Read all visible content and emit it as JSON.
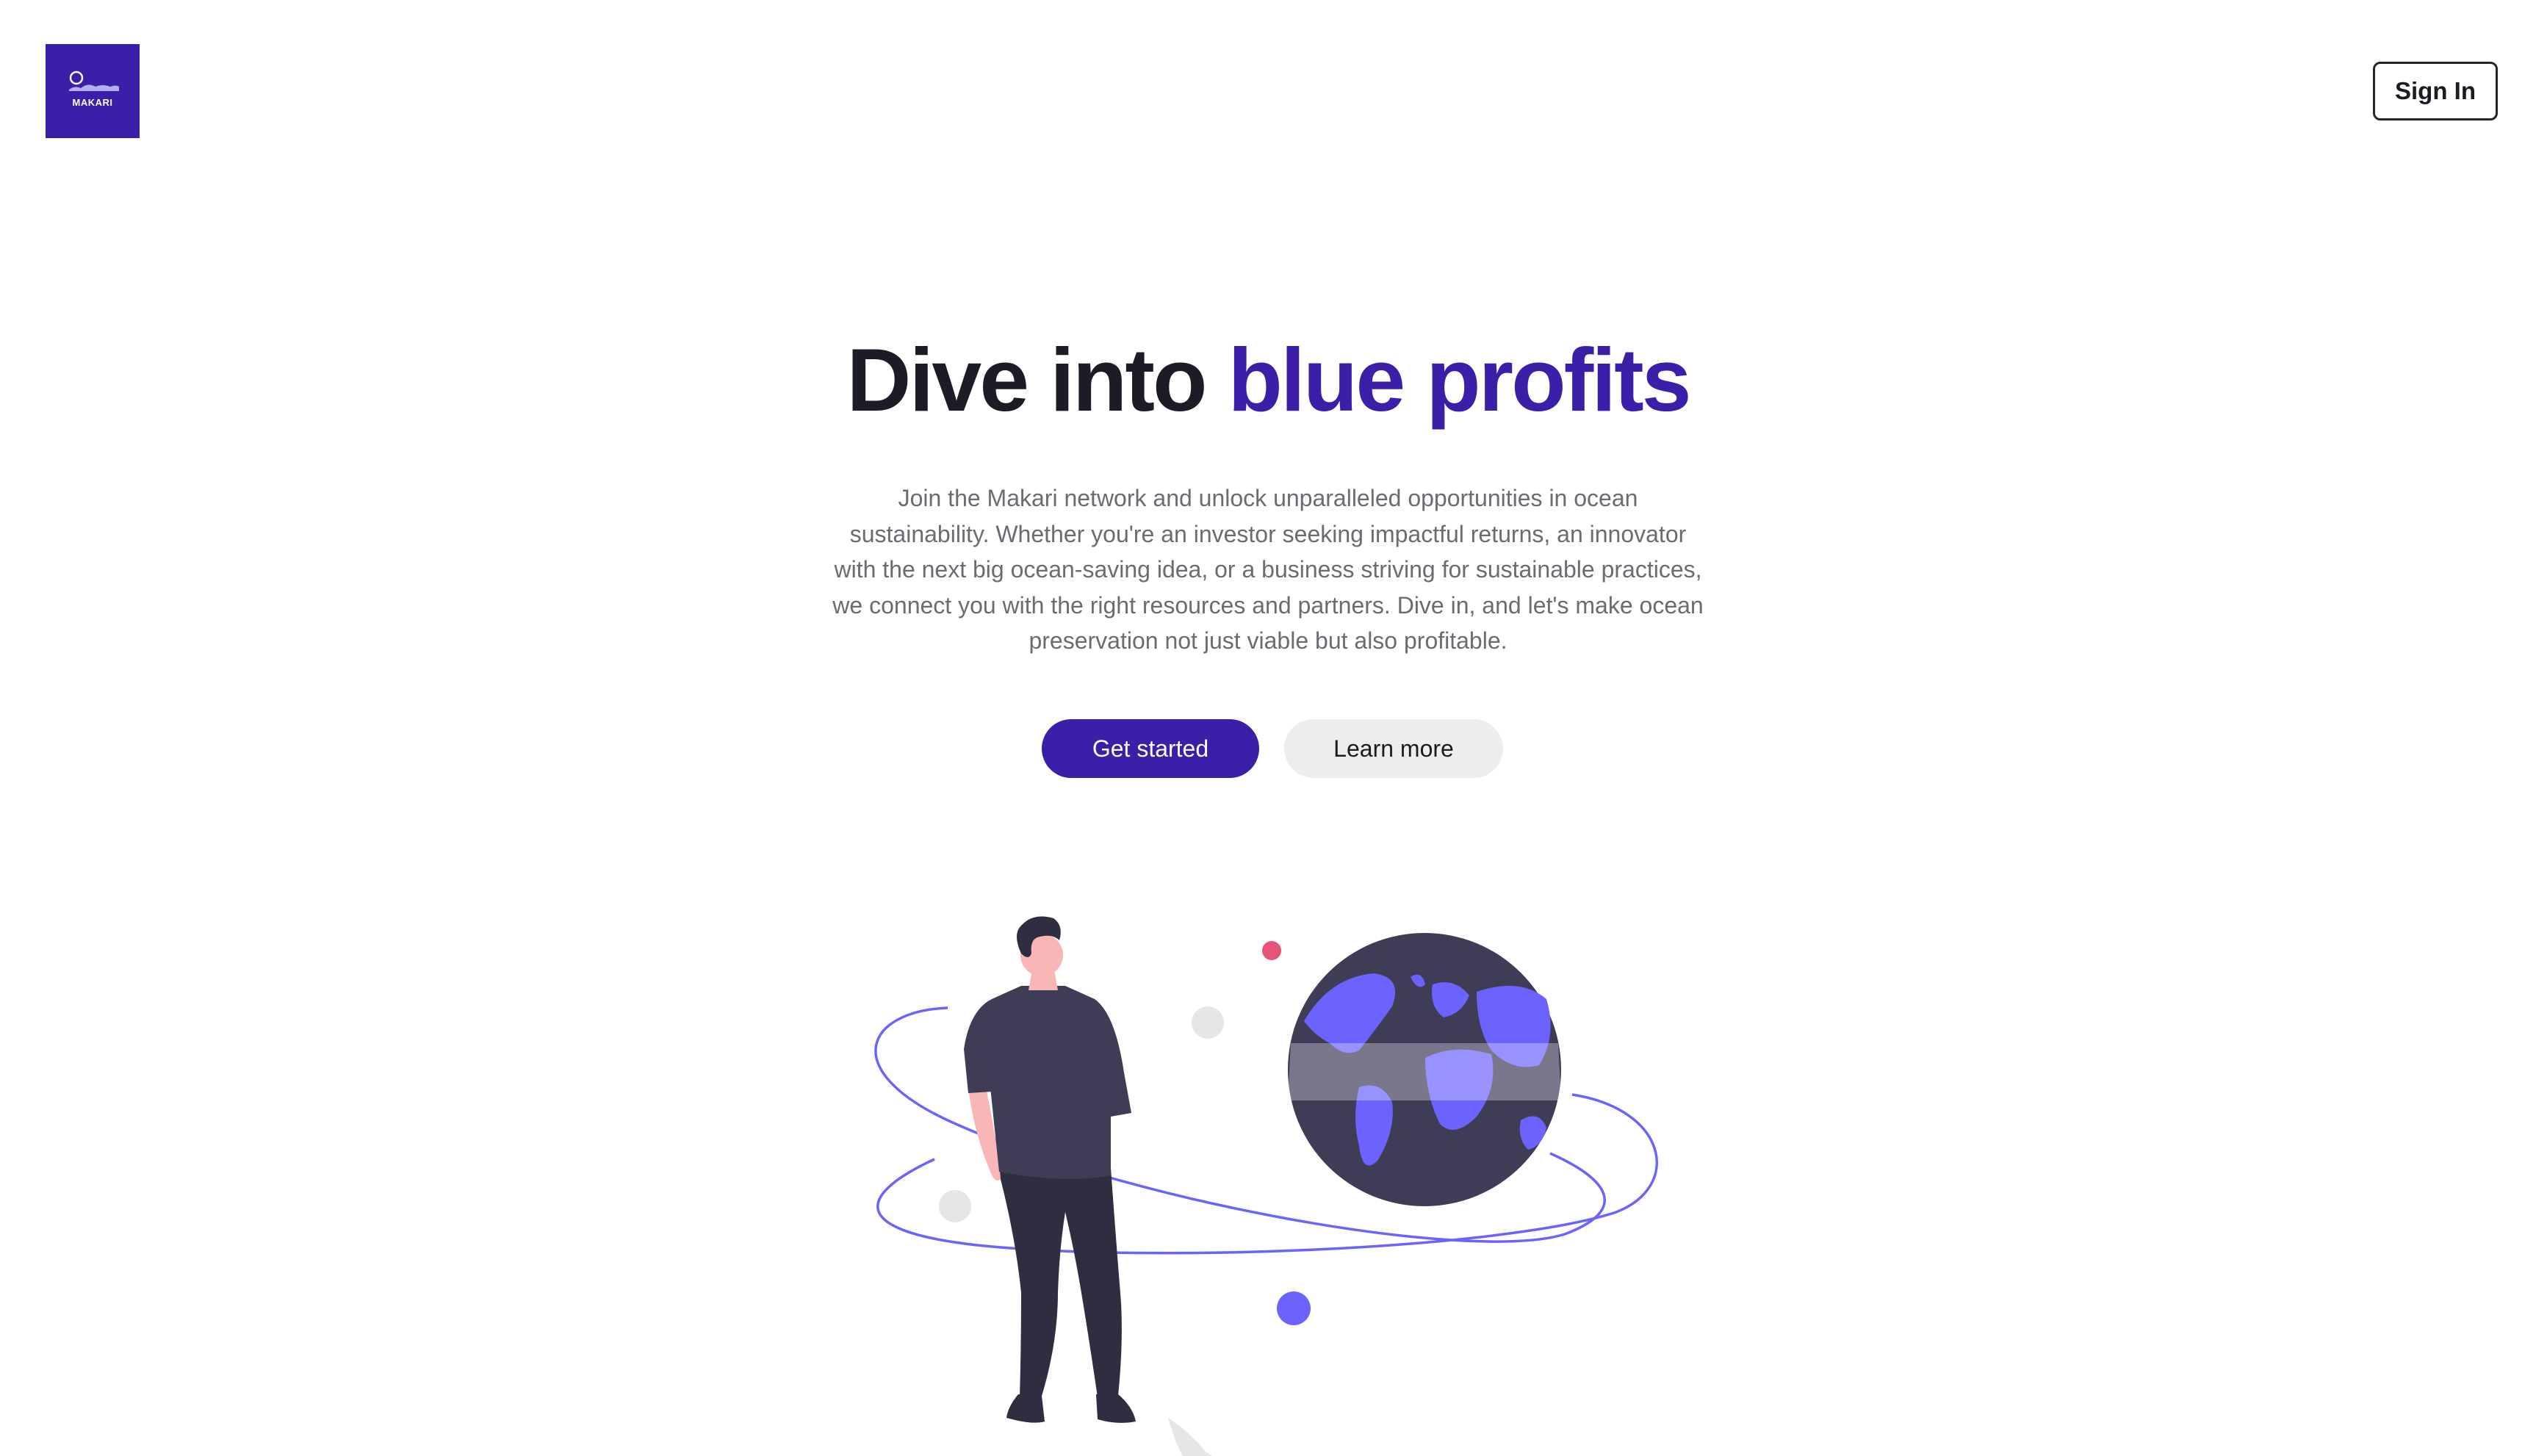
{
  "header": {
    "logo_text": "MAKARI",
    "sign_in_label": "Sign In"
  },
  "hero": {
    "title_part1": "Dive into ",
    "title_part2": "blue profits",
    "description": "Join the Makari network and unlock unparalleled opportunities in ocean sustainability. Whether you're an investor seeking impactful returns, an innovator with the next big ocean-saving idea, or a business striving for sustainable practices, we connect you with the right resources and partners. Dive in, and let's make ocean preservation not just viable but also profitable.",
    "primary_button": "Get started",
    "secondary_button": "Learn more"
  },
  "colors": {
    "brand": "#3b1fa8",
    "accent_purple": "#6c63ff",
    "dark": "#3f3d56",
    "skin": "#f9b6b6",
    "pink_dot": "#e8537a"
  },
  "illustration": {
    "icon": "person-globe-illustration"
  }
}
